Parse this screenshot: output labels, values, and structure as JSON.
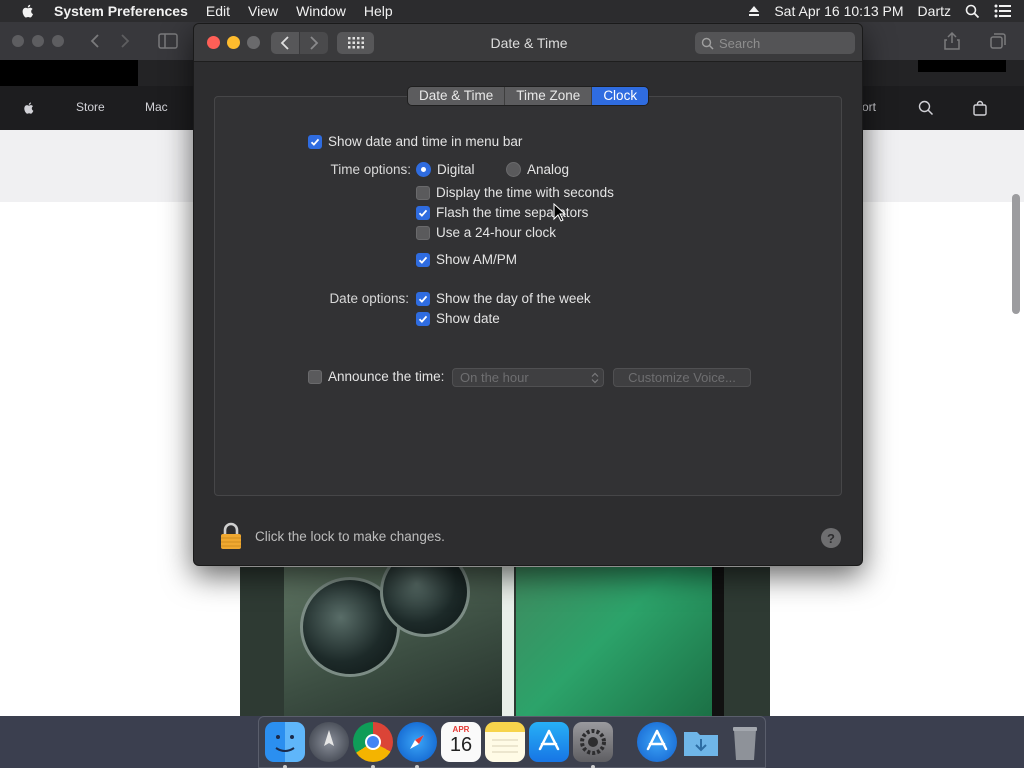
{
  "menubar": {
    "app_name": "System Preferences",
    "menus": [
      "Edit",
      "View",
      "Window",
      "Help"
    ],
    "datetime": "Sat Apr 16  10:13 PM",
    "user": "Dartz"
  },
  "browser": {
    "nav": {
      "store": "Store",
      "mac": "Mac",
      "support": "ort"
    }
  },
  "window": {
    "title": "Date & Time",
    "search_placeholder": "Search",
    "tabs": [
      {
        "label": "Date & Time",
        "active": false
      },
      {
        "label": "Time Zone",
        "active": false
      },
      {
        "label": "Clock",
        "active": true
      }
    ],
    "clock": {
      "show_in_menu_bar": {
        "label": "Show date and time in menu bar",
        "checked": true
      },
      "time_options_label": "Time options:",
      "digital": {
        "label": "Digital",
        "selected": true
      },
      "analog": {
        "label": "Analog",
        "selected": false
      },
      "seconds": {
        "label": "Display the time with seconds",
        "checked": false
      },
      "flash_separators": {
        "label": "Flash the time separators",
        "checked": true
      },
      "hour24": {
        "label": "Use a 24-hour clock",
        "checked": false
      },
      "show_ampm": {
        "label": "Show AM/PM",
        "checked": true
      },
      "date_options_label": "Date options:",
      "day_of_week": {
        "label": "Show the day of the week",
        "checked": true
      },
      "show_date": {
        "label": "Show date",
        "checked": true
      },
      "announce": {
        "label": "Announce the time:",
        "checked": false
      },
      "interval_value": "On the hour",
      "customize_voice_label": "Customize Voice..."
    },
    "lock_text": "Click the lock to make changes.",
    "help_label": "?"
  },
  "colors": {
    "accent": "#2f6ce0",
    "close": "#ff5f57",
    "minimize": "#febc2e"
  },
  "dock": {
    "calendar_month": "APR",
    "calendar_day": "16"
  }
}
